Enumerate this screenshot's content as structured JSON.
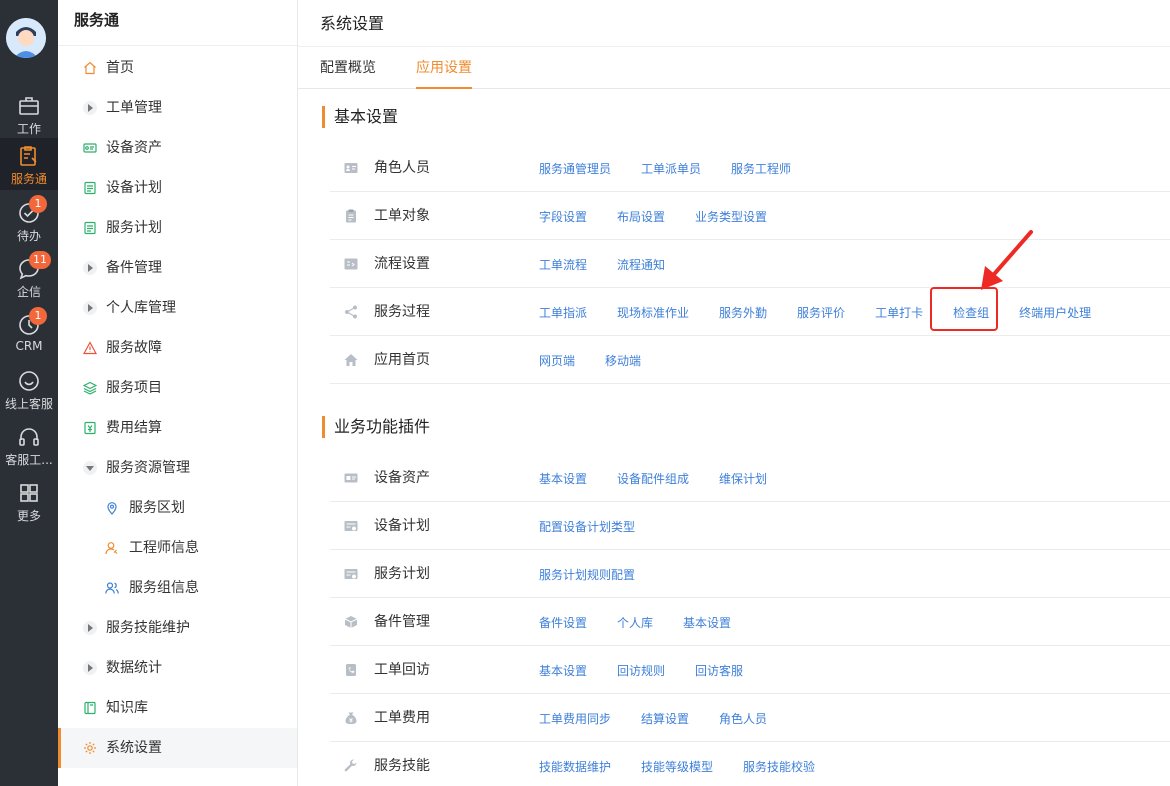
{
  "rail": {
    "items": [
      {
        "label": "工作",
        "icon": "briefcase-icon"
      },
      {
        "label": "服务通",
        "icon": "clipboard-wrench-icon",
        "active": true
      },
      {
        "label": "待办",
        "icon": "check-circle-icon",
        "badge": "1"
      },
      {
        "label": "企信",
        "icon": "chat-bubble-icon",
        "badge": "11"
      },
      {
        "label": "CRM",
        "icon": "clock-icon",
        "badge": "1"
      },
      {
        "label": "线上客服",
        "icon": "smile-chat-icon"
      },
      {
        "label": "客服工...",
        "icon": "headset-icon"
      },
      {
        "label": "更多",
        "icon": "grid-icon"
      }
    ]
  },
  "sidebar": {
    "title": "服务通",
    "items": [
      {
        "label": "首页",
        "icon": "home-icon"
      },
      {
        "label": "工单管理",
        "icon": "caret-right-icon"
      },
      {
        "label": "设备资产",
        "icon": "device-icon"
      },
      {
        "label": "设备计划",
        "icon": "doc-icon"
      },
      {
        "label": "服务计划",
        "icon": "doc-icon"
      },
      {
        "label": "备件管理",
        "icon": "caret-right-icon"
      },
      {
        "label": "个人库管理",
        "icon": "caret-right-icon"
      },
      {
        "label": "服务故障",
        "icon": "warning-icon"
      },
      {
        "label": "服务项目",
        "icon": "layers-icon"
      },
      {
        "label": "费用结算",
        "icon": "money-icon"
      },
      {
        "label": "服务资源管理",
        "icon": "caret-down-icon"
      },
      {
        "label": "服务区划",
        "icon": "location-icon"
      },
      {
        "label": "工程师信息",
        "icon": "engineer-icon"
      },
      {
        "label": "服务组信息",
        "icon": "group-icon"
      },
      {
        "label": "服务技能维护",
        "icon": "caret-right-icon"
      },
      {
        "label": "数据统计",
        "icon": "caret-right-icon"
      },
      {
        "label": "知识库",
        "icon": "book-icon"
      },
      {
        "label": "系统设置",
        "icon": "gear-icon",
        "active": true
      }
    ]
  },
  "main": {
    "title": "系统设置",
    "tabs": [
      {
        "label": "配置概览"
      },
      {
        "label": "应用设置",
        "active": true
      }
    ],
    "sections": [
      {
        "title": "基本设置",
        "rows": [
          {
            "label": "角色人员",
            "icon": "id-card-icon",
            "links": [
              "服务通管理员",
              "工单派单员",
              "服务工程师"
            ]
          },
          {
            "label": "工单对象",
            "icon": "clipboard-icon",
            "links": [
              "字段设置",
              "布局设置",
              "业务类型设置"
            ]
          },
          {
            "label": "流程设置",
            "icon": "flow-icon",
            "links": [
              "工单流程",
              "流程通知"
            ]
          },
          {
            "label": "服务过程",
            "icon": "share-nodes-icon",
            "links": [
              "工单指派",
              "现场标准作业",
              "服务外勤",
              "服务评价",
              "工单打卡",
              "检查组",
              "终端用户处理"
            ]
          },
          {
            "label": "应用首页",
            "icon": "house-icon",
            "links": [
              "网页端",
              "移动端"
            ]
          }
        ]
      },
      {
        "title": "业务功能插件",
        "rows": [
          {
            "label": "设备资产",
            "icon": "device-card-icon",
            "links": [
              "基本设置",
              "设备配件组成",
              "维保计划"
            ]
          },
          {
            "label": "设备计划",
            "icon": "plan-icon",
            "links": [
              "配置设备计划类型"
            ]
          },
          {
            "label": "服务计划",
            "icon": "plan-icon",
            "links": [
              "服务计划规则配置"
            ]
          },
          {
            "label": "备件管理",
            "icon": "box-icon",
            "links": [
              "备件设置",
              "个人库",
              "基本设置"
            ]
          },
          {
            "label": "工单回访",
            "icon": "phone-icon",
            "links": [
              "基本设置",
              "回访规则",
              "回访客服"
            ]
          },
          {
            "label": "工单费用",
            "icon": "money-bag-icon",
            "links": [
              "工单费用同步",
              "结算设置",
              "角色人员"
            ]
          },
          {
            "label": "服务技能",
            "icon": "wrench-icon",
            "links": [
              "技能数据维护",
              "技能等级模型",
              "服务技能校验"
            ]
          }
        ]
      }
    ]
  },
  "colors": {
    "accent": "#f08c2f",
    "link": "#3e7fd8",
    "highlight": "#ee2a24",
    "rail": "#2b2f36"
  }
}
